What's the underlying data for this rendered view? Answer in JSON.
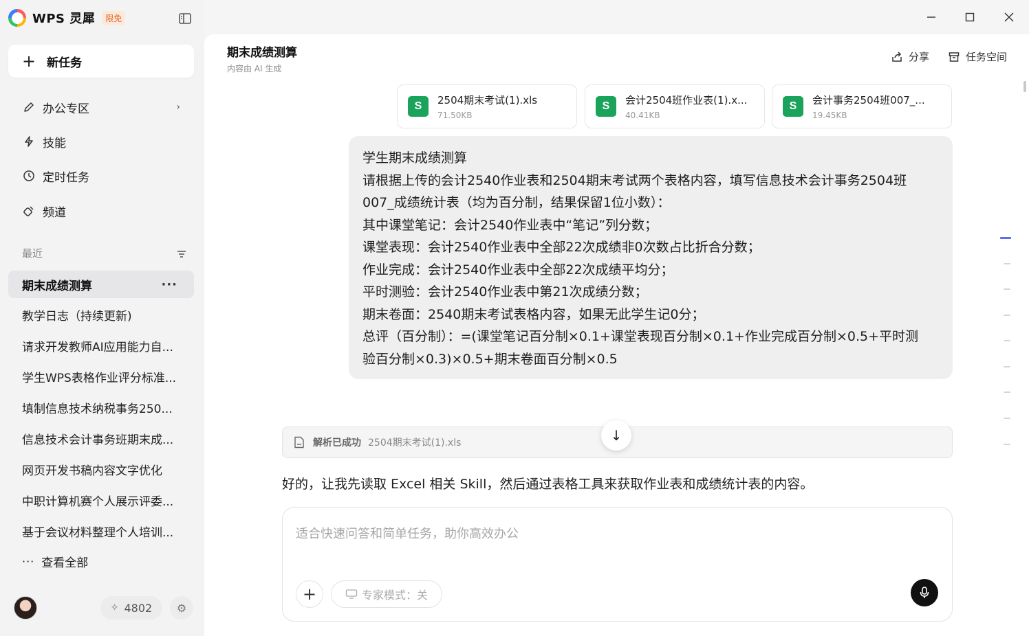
{
  "app": {
    "name": "WPS 灵犀",
    "badge": "限免"
  },
  "sidebar": {
    "new_task": "新任务",
    "nav": [
      {
        "label": "办公专区",
        "icon": "pencil-icon"
      },
      {
        "label": "技能",
        "icon": "lightning-icon"
      },
      {
        "label": "定时任务",
        "icon": "clock-icon"
      },
      {
        "label": "频道",
        "icon": "channel-icon"
      }
    ],
    "recent_title": "最近",
    "recent": [
      "期末成绩测算",
      "教学日志（持续更新)",
      "请求开发教师AI应用能力自...",
      "学生WPS表格作业评分标准...",
      "填制信息技术纳税事务250...",
      "信息技术会计事务班期末成...",
      "网页开发书稿内容文字优化",
      "中职计算机赛个人展示评委...",
      "基于会议材料整理个人培训..."
    ],
    "view_all": "查看全部",
    "credits": "4802"
  },
  "header": {
    "title": "期末成绩测算",
    "subtitle": "内容由 AI 生成",
    "share": "分享",
    "workspace": "任务空间"
  },
  "files": [
    {
      "name": "2504期末考试(1).xls",
      "size": "71.50KB",
      "icon_letter": "S"
    },
    {
      "name": "会计2504班作业表(1).x...",
      "size": "40.41KB",
      "icon_letter": "S"
    },
    {
      "name": "会计事务2504班007_...",
      "size": "19.45KB",
      "icon_letter": "S"
    }
  ],
  "user_message": [
    "学生期末成绩测算",
    "请根据上传的会计2540作业表和2504期末考试两个表格内容，填写信息技术会计事务2504班",
    "007_成绩统计表（均为百分制，结果保留1位小数）：",
    "其中课堂笔记：会计2540作业表中“笔记”列分数；",
    "课堂表现：会计2540作业表中全部22次成绩非0次数占比折合分数；",
    "作业完成：会计2540作业表中全部22次成绩平均分；",
    "平时测验：会计2540作业表中第21次成绩分数；",
    "期末卷面：2540期末考试表格内容，如果无此学生记0分；",
    "总评（百分制）：=(课堂笔记百分制×0.1+课堂表现百分制×0.1+作业完成百分制×0.5+平时测",
    "验百分制×0.3)×0.5+期末卷面百分制×0.5"
  ],
  "parse_status": {
    "status": "解析已成功",
    "file": "2504期末考试(1).xls"
  },
  "assistant_reply": "好的，让我先读取 Excel 相关 Skill，然后通过表格工具来获取作业表和成绩统计表的内容。",
  "composer": {
    "placeholder": "适合快速问答和简单任务，助你高效办公",
    "mode": "专家模式：关"
  },
  "colors": {
    "accent": "#5a6cf0",
    "sheet_green": "#1aa35a",
    "badge_orange": "#e06a2a"
  }
}
